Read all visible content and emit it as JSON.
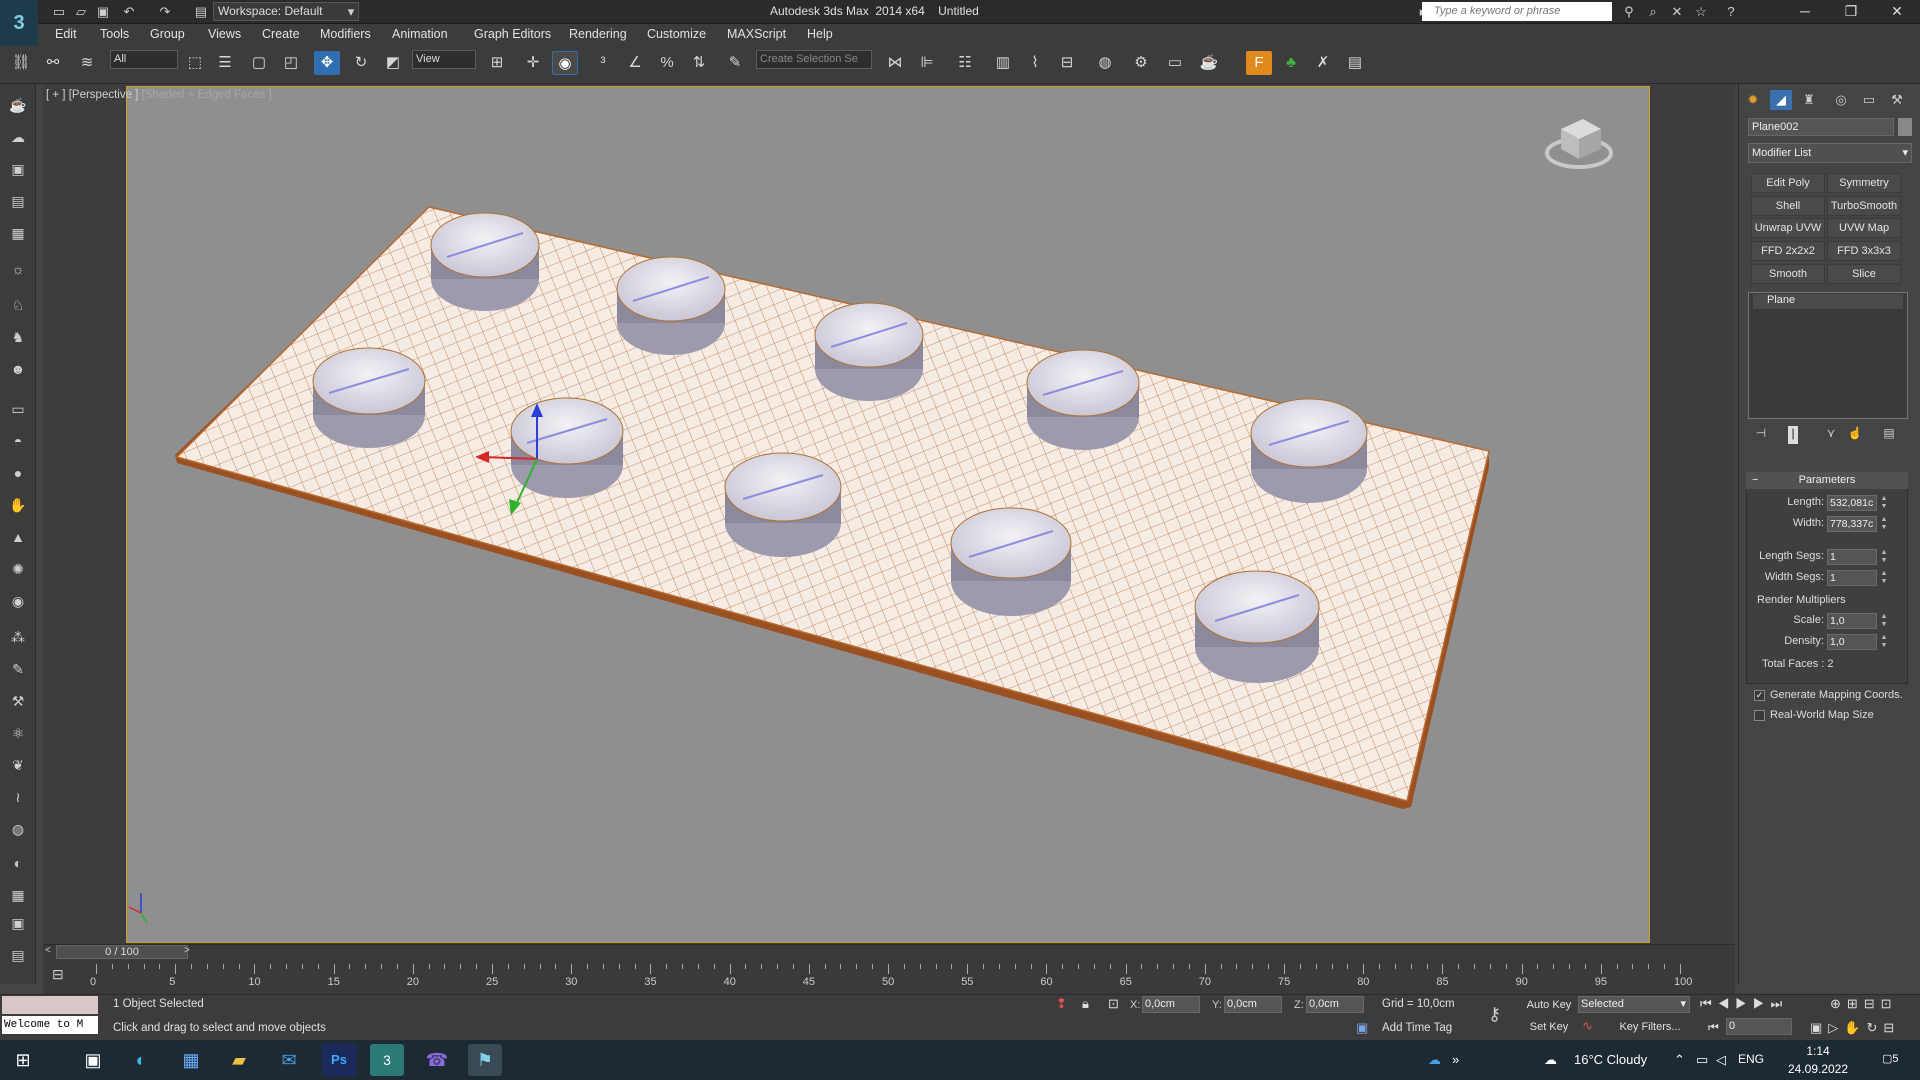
{
  "window": {
    "app_title": "Autodesk 3ds Max  2014 x64",
    "doc_title": "Untitled",
    "workspace": "Workspace: Default",
    "search_placeholder": "Type a keyword or phrase",
    "minimize": "─",
    "maximize": "❐",
    "close": "✕"
  },
  "menu": [
    "Edit",
    "Tools",
    "Group",
    "Views",
    "Create",
    "Modifiers",
    "Animation",
    "Graph Editors",
    "Rendering",
    "Customize",
    "MAXScript",
    "Help"
  ],
  "toolbar": {
    "selection_filter": "All",
    "ref_coord": "View",
    "named_selection": "Create Selection Se"
  },
  "viewport": {
    "label_bracket": "[ + ]",
    "label_view": "[Perspective ]",
    "label_shading": "[Shaded + Edged Faces ]"
  },
  "command_panel": {
    "object_name": "Plane002",
    "modifier_list": "Modifier List",
    "modifier_buttons": [
      "Edit Poly",
      "Symmetry",
      "Shell",
      "TurboSmooth",
      "Unwrap UVW",
      "UVW Map",
      "FFD 2x2x2",
      "FFD 3x3x3",
      "Smooth",
      "Slice"
    ],
    "stack_item": "Plane",
    "rollout_title": "Parameters",
    "length_label": "Length:",
    "length_value": "532,081c",
    "width_label": "Width:",
    "width_value": "778,337c",
    "length_segs_label": "Length Segs:",
    "length_segs_value": "1",
    "width_segs_label": "Width Segs:",
    "width_segs_value": "1",
    "render_multipliers": "Render Multipliers",
    "scale_label": "Scale:",
    "scale_value": "1,0",
    "density_label": "Density:",
    "density_value": "1,0",
    "total_faces": "Total Faces : 2",
    "gen_mapping": "Generate Mapping Coords.",
    "real_world": "Real-World Map Size"
  },
  "timeline": {
    "frame_display": "0 / 100",
    "ticks": [
      "0",
      "5",
      "10",
      "15",
      "20",
      "25",
      "30",
      "35",
      "40",
      "45",
      "50",
      "55",
      "60",
      "65",
      "70",
      "75",
      "80",
      "85",
      "90",
      "95",
      "100"
    ]
  },
  "status": {
    "maxscript_out": "Welcome to M",
    "selection": "1 Object Selected",
    "prompt": "Click and drag to select and move objects",
    "x_label": "X:",
    "x_value": "0,0cm",
    "y_label": "Y:",
    "y_value": "0,0cm",
    "z_label": "Z:",
    "z_value": "0,0cm",
    "grid": "Grid = 10,0cm",
    "add_time_tag": "Add Time Tag",
    "auto_key": "Auto Key",
    "set_key": "Set Key",
    "key_mode": "Selected",
    "key_filters": "Key Filters...",
    "frame_value": "0"
  },
  "taskbar": {
    "weather": "16°C  Cloudy",
    "lang": "ENG",
    "time": "1:14",
    "date": "24.09.2022",
    "notif": "5"
  }
}
